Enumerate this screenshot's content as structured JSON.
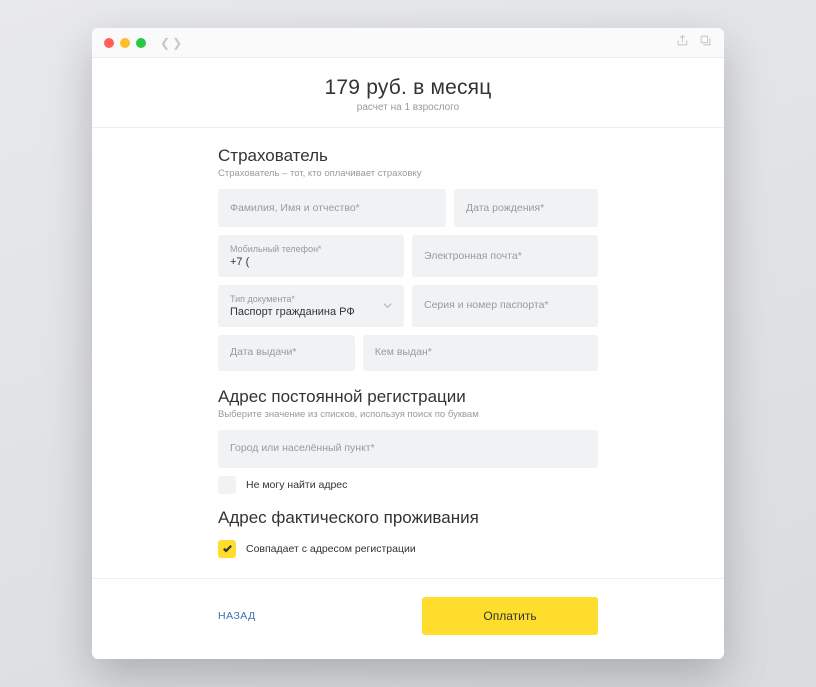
{
  "price": {
    "headline": "179 руб. в месяц",
    "sub": "расчет на 1 взрослого"
  },
  "policyholder": {
    "title": "Страхователь",
    "sub": "Страхователь – тот, кто оплачивает страховку",
    "fullname_ph": "Фамилия, Имя и отчество*",
    "birthdate_ph": "Дата рождения*",
    "phone_lbl": "Мобильный телефон*",
    "phone_val": "+7 (",
    "email_ph": "Электронная почта*",
    "doctype_lbl": "Тип документа*",
    "doctype_val": "Паспорт гражданина РФ",
    "docnum_ph": "Серия и номер паспорта*",
    "issuedate_ph": "Дата выдачи*",
    "issuedby_ph": "Кем выдан*"
  },
  "reg_address": {
    "title": "Адрес постоянной регистрации",
    "sub": "Выберите значение из списков, используя поиск по буквам",
    "city_ph": "Город или населённый пункт*",
    "cant_find": "Не могу найти адрес"
  },
  "actual_address": {
    "title": "Адрес фактического проживания",
    "same_as_reg": "Совпадает с адресом регистрации"
  },
  "footer": {
    "back": "НАЗАД",
    "pay": "Оплатить"
  }
}
